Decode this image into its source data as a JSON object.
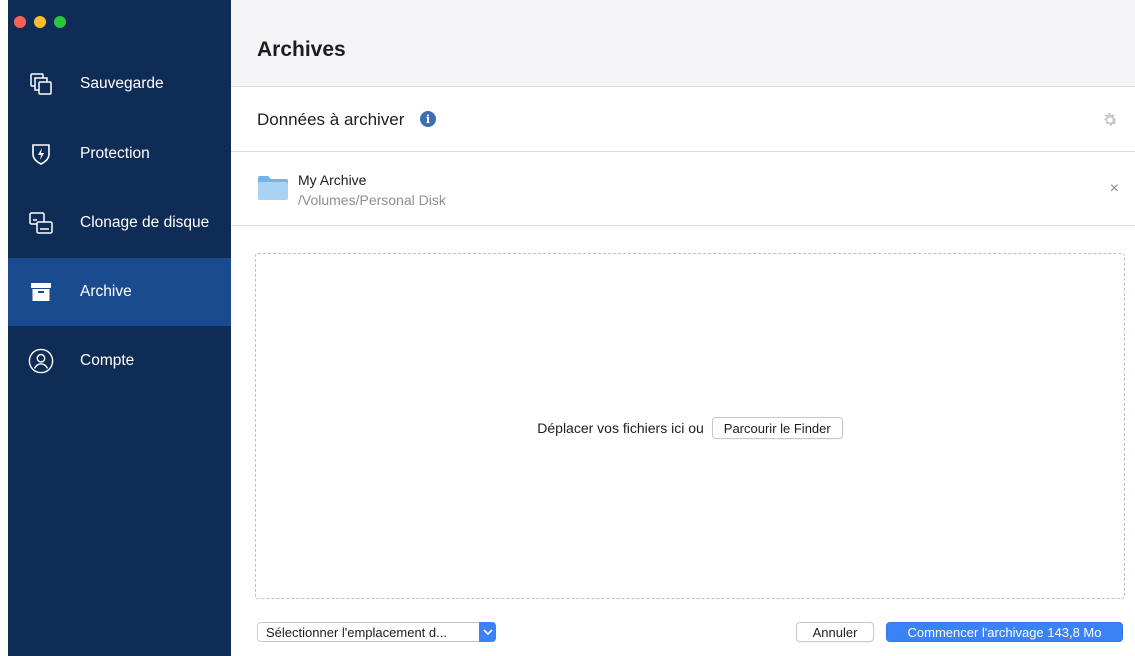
{
  "window": {
    "controls": [
      "close",
      "minimize",
      "zoom"
    ]
  },
  "sidebar": {
    "items": [
      {
        "label": "Sauvegarde",
        "icon": "backup-icon"
      },
      {
        "label": "Protection",
        "icon": "shield-icon"
      },
      {
        "label": "Clonage de disque",
        "icon": "disk-clone-icon"
      },
      {
        "label": "Archive",
        "icon": "archive-box-icon",
        "active": true
      },
      {
        "label": "Compte",
        "icon": "account-icon"
      }
    ]
  },
  "header": {
    "title": "Archives"
  },
  "section": {
    "title": "Données à archiver",
    "info_icon": "i"
  },
  "archive_item": {
    "name": "My Archive",
    "path": "/Volumes/Personal Disk",
    "close": "×"
  },
  "drop_zone": {
    "text": "Déplacer vos fichiers ici ou",
    "browse_button": "Parcourir le Finder"
  },
  "footer": {
    "location_select": "Sélectionner l'emplacement d...",
    "cancel_button": "Annuler",
    "start_button": "Commencer l'archivage 143,8 Mo"
  },
  "colors": {
    "sidebar_bg": "#0f2c56",
    "sidebar_active": "#1a4b8f",
    "accent": "#3b82f6",
    "info": "#3f6fb0"
  }
}
